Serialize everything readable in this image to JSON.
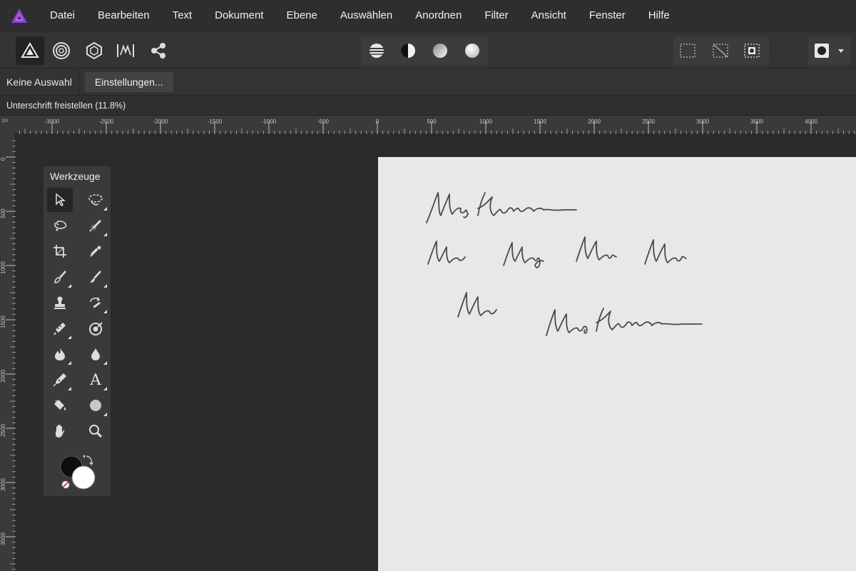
{
  "app": {
    "logo_icon": "affinity-photo-logo-icon",
    "brand_color": "#8e3fd3"
  },
  "menu": [
    "Datei",
    "Bearbeiten",
    "Text",
    "Dokument",
    "Ebene",
    "Auswählen",
    "Anordnen",
    "Filter",
    "Ansicht",
    "Fenster",
    "Hilfe"
  ],
  "toolbar": {
    "personas": [
      "photo-persona-icon",
      "liquify-persona-icon",
      "develop-persona-icon",
      "tone-mapping-persona-icon",
      "export-persona-icon"
    ],
    "adjust_buttons": [
      "auto-levels-icon",
      "auto-contrast-icon",
      "auto-colors-icon",
      "auto-white-balance-icon"
    ],
    "selection_buttons": [
      "marquee-select-icon",
      "deselect-icon",
      "invert-selection-icon"
    ],
    "mask_button": "quick-mask-icon"
  },
  "context": {
    "selection_status": "Keine Auswahl",
    "settings_button": "Einstellungen..."
  },
  "document": {
    "tab_title": "Unterschrift freistellen (11.8%)"
  },
  "rulers": {
    "unit": "px",
    "top_labels": [
      "-3000",
      "-2500",
      "-2000",
      "-1500",
      "-1000",
      "-500",
      "0",
      "500",
      "1000",
      "1500",
      "2000",
      "2500",
      "3000",
      "3500",
      "4000"
    ],
    "left_labels": [
      "0",
      "500",
      "1000",
      "1500",
      "2000",
      "2500",
      "3000",
      "3500"
    ]
  },
  "tools_panel": {
    "title": "Werkzeuge",
    "tools": [
      {
        "name": "move-tool-icon",
        "active": true,
        "sub": false
      },
      {
        "name": "selection-brush-tool-icon",
        "active": false,
        "sub": true
      },
      {
        "name": "freehand-selection-tool-icon",
        "active": false,
        "sub": false
      },
      {
        "name": "color-picker-tool-icon",
        "active": false,
        "sub": true
      },
      {
        "name": "crop-tool-icon",
        "active": false,
        "sub": false
      },
      {
        "name": "eyedropper-tool-icon",
        "active": false,
        "sub": false
      },
      {
        "name": "paint-brush-tool-icon",
        "active": false,
        "sub": true
      },
      {
        "name": "brush-tool-icon",
        "active": false,
        "sub": true
      },
      {
        "name": "clone-stamp-tool-icon",
        "active": false,
        "sub": false
      },
      {
        "name": "undo-brush-tool-icon",
        "active": false,
        "sub": true
      },
      {
        "name": "healing-brush-tool-icon",
        "active": false,
        "sub": true
      },
      {
        "name": "red-eye-tool-icon",
        "active": false,
        "sub": false
      },
      {
        "name": "burn-tool-icon",
        "active": false,
        "sub": true
      },
      {
        "name": "blur-tool-icon",
        "active": false,
        "sub": true
      },
      {
        "name": "pen-tool-icon",
        "active": false,
        "sub": true
      },
      {
        "name": "artistic-text-tool-icon",
        "active": false,
        "sub": true
      },
      {
        "name": "fill-tool-icon",
        "active": false,
        "sub": false
      },
      {
        "name": "shape-tool-icon",
        "active": false,
        "sub": true
      },
      {
        "name": "hand-tool-icon",
        "active": false,
        "sub": false
      },
      {
        "name": "zoom-tool-icon",
        "active": false,
        "sub": false
      }
    ],
    "text_glyph": "A",
    "primary_color": "#0e0e0e",
    "secondary_color": "#ffffff"
  }
}
